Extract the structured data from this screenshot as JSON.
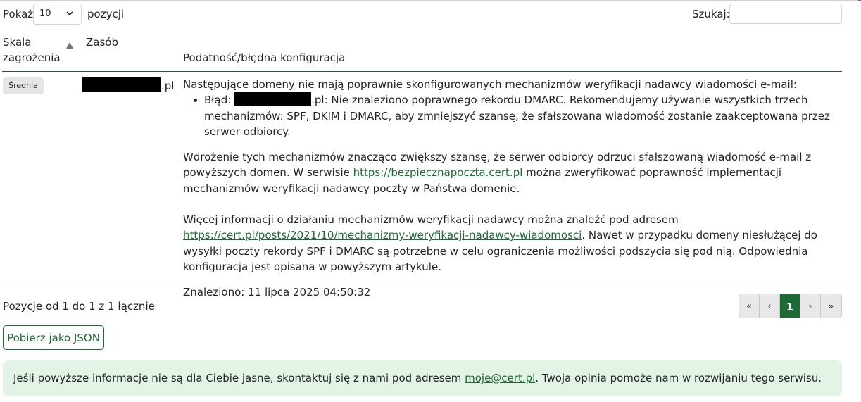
{
  "controls": {
    "show_label": "Pokaż",
    "page_size_value": "10",
    "after_label": "pozycji",
    "search_label": "Szukaj:",
    "search_value": ""
  },
  "table": {
    "headers": {
      "severity_line1": "Skala",
      "severity_line2": "zagrożenia",
      "resource": "Zasób",
      "vulnerability": "Podatność/błędna konfiguracja"
    },
    "row": {
      "severity_badge": "Średnia",
      "resource_suffix": ".pl",
      "intro": "Następujące domeny nie mają poprawnie skonfigurowanych mechanizmów weryfikacji nadawcy wiadomości e-mail:",
      "error_prefix": "Błąd:",
      "error_text": ".pl: Nie znaleziono poprawnego rekordu DMARC. Rekomendujemy używanie wszystkich trzech mechanizmów: SPF, DKIM i DMARC, aby zmniejszyć szansę, że sfałszowana wiadomość zostanie zaakceptowana przez serwer odbiorcy.",
      "para1_before": "Wdrożenie tych mechanizmów znacząco zwiększy szansę, że serwer odbiorcy odrzuci sfałszowaną wiadomość e-mail z powyższych domen. W serwisie ",
      "para1_link": "https://bezpiecznapoczta.cert.pl",
      "para1_after": " można zweryfikować poprawność implementacji mechanizmów weryfikacji nadawcy poczty w Państwa domenie.",
      "para2_before": "Więcej informacji o działaniu mechanizmów weryfikacji nadawcy można znaleźć pod adresem ",
      "para2_link": "https://cert.pl/posts/2021/10/mechanizmy-weryfikacji-nadawcy-wiadomosci",
      "para2_after": ". Nawet w przypadku domeny niesłużącej do wysyłki poczty rekordy SPF i DMARC są potrzebne w celu ograniczenia możliwości podszycia się pod nią. Odpowiednia konfiguracja jest opisana w powyższym artykule.",
      "found": "Znaleziono: 11 lipca 2025 04:50:32"
    }
  },
  "footer": {
    "info": "Pozycje od 1 do 1 z 1 łącznie",
    "pagination": {
      "first": "«",
      "prev": "‹",
      "current": "1",
      "next": "›",
      "last": "»"
    },
    "json_button": "Pobierz jako JSON"
  },
  "alert": {
    "before": "Jeśli powyższe informacje nie są dla Ciebie jasne, skontaktuj się z nami pod adresem ",
    "email": "moje@cert.pl",
    "after": ". Twoja opinia pomoże nam w rozwijaniu tego serwisu."
  },
  "colors": {
    "accent": "#1c6b35",
    "alert_bg": "#e3f4e6",
    "badge_bg": "#e6e6e6"
  }
}
